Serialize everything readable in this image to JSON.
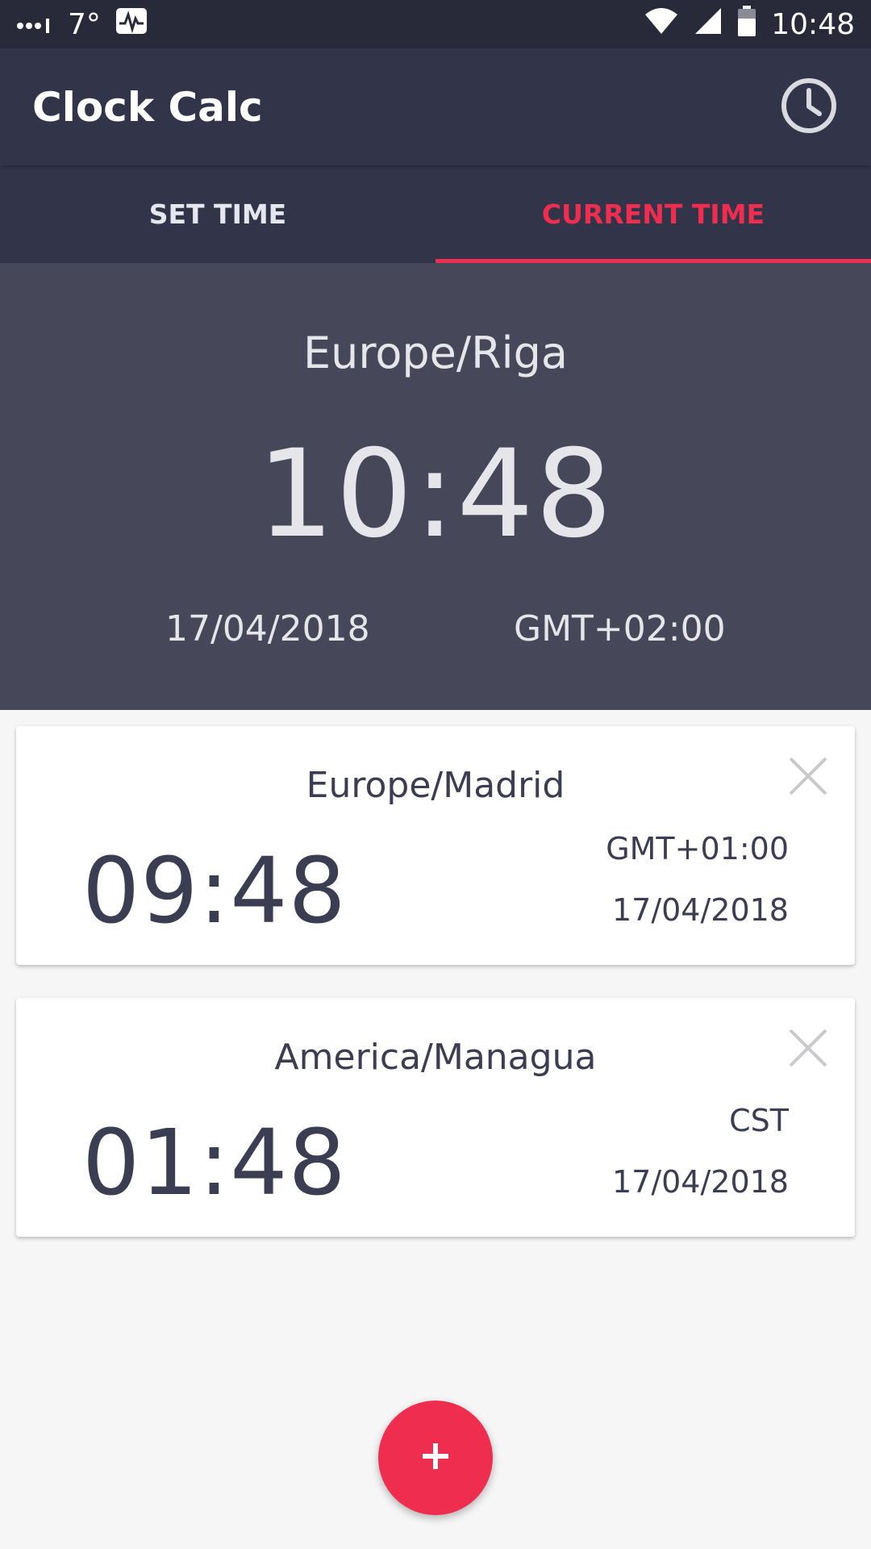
{
  "status_bar": {
    "signal_icon": "signal-dots-icon",
    "temperature": "7°",
    "activity_icon": "activity-icon",
    "wifi_icon": "wifi-icon",
    "cell_icon": "cell-signal-icon",
    "battery_icon": "battery-icon",
    "time": "10:48"
  },
  "app_bar": {
    "title": "Clock Calc",
    "history_icon": "clock-icon"
  },
  "tabs": [
    {
      "label": "SET TIME",
      "active": false
    },
    {
      "label": "CURRENT TIME",
      "active": true
    }
  ],
  "main_clock": {
    "zone": "Europe/Riga",
    "time": "10:48",
    "date": "17/04/2018",
    "offset": "GMT+02:00"
  },
  "cards": [
    {
      "zone": "Europe/Madrid",
      "time": "09:48",
      "offset": "GMT+01:00",
      "date": "17/04/2018"
    },
    {
      "zone": "America/Managua",
      "time": "01:48",
      "offset": "CST",
      "date": "17/04/2018"
    }
  ],
  "fab": {
    "icon": "plus-icon"
  },
  "colors": {
    "accent": "#ef2d4e",
    "app_bar": "#32344a",
    "hero_bg": "#464759",
    "card_text": "#3b3d52"
  }
}
